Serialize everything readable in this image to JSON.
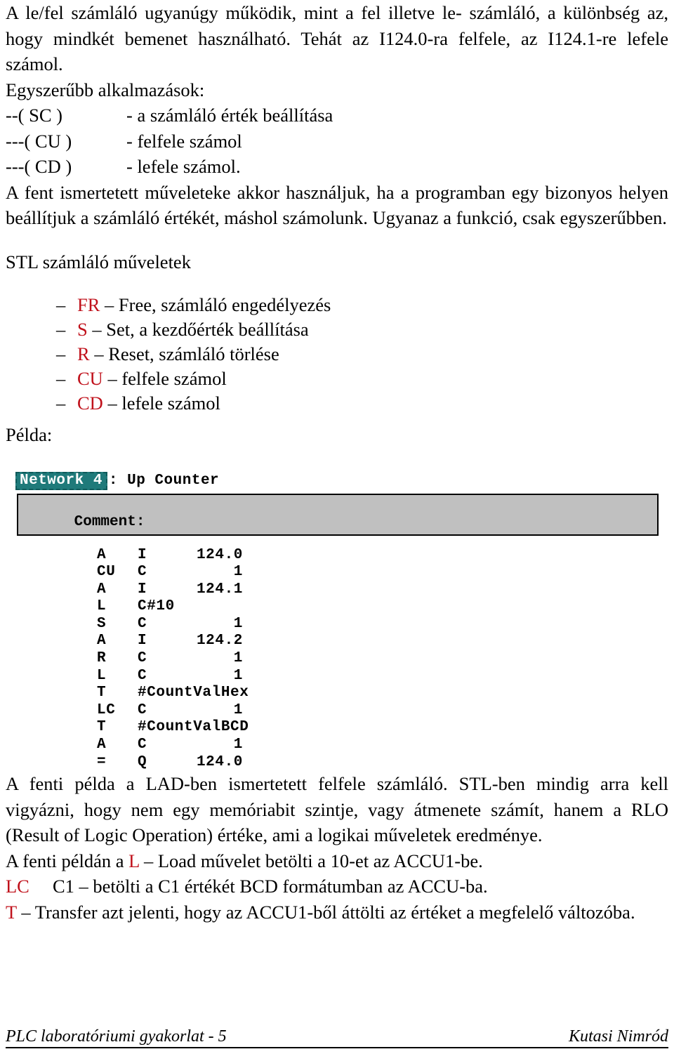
{
  "document": {
    "intro_paragraph": "A le/fel számláló ugyanúgy működik, mint a fel illetve le- számláló, a különbség az, hogy mindkét bemenet használható. Tehát az I124.0-ra felfele, az I124.1-re lefele számol.",
    "applications_heading": "Egyszerűbb alkalmazások:",
    "coil_rows": [
      {
        "symbol": "--( SC )",
        "description": "- a számláló érték beállítása"
      },
      {
        "symbol": "---( CU )",
        "description": "- felfele számol"
      },
      {
        "symbol": "---( CD )",
        "description": "- lefele számol."
      }
    ],
    "usage_paragraph": "A fent ismertetett műveleteke akkor használjuk, ha a programban egy bizonyos helyen beállítjuk a számláló értékét, máshol számolunk. Ugyanaz a funkció, csak egyszerűbben.",
    "stl_heading": "STL számláló műveletek",
    "stl_list": [
      {
        "bullet": "–",
        "code": "FR",
        "separator": " – ",
        "text": "Free, számláló engedélyezés"
      },
      {
        "bullet": "–",
        "code": "S",
        "separator": " – ",
        "text": "Set, a kezdőérték beállítása"
      },
      {
        "bullet": "–",
        "code": "R",
        "separator": " – ",
        "text": "Reset, számláló törlése"
      },
      {
        "bullet": "–",
        "code": "CU",
        "separator": " – ",
        "text": "felfele számol"
      },
      {
        "bullet": "–",
        "code": "CD",
        "separator": " – ",
        "text": "lefele számol"
      }
    ],
    "example_label": "Példa:",
    "screenshot": {
      "network_label": "Network 4",
      "network_title": ": Up Counter",
      "comment_label": "Comment:",
      "code_lines": [
        {
          "op": "A",
          "area": "I",
          "addr": "124.0"
        },
        {
          "op": "CU",
          "area": "C",
          "addr": "1"
        },
        {
          "op": "A",
          "area": "I",
          "addr": "124.1"
        },
        {
          "op": "L",
          "area": "C#10",
          "addr": ""
        },
        {
          "op": "S",
          "area": "C",
          "addr": "1"
        },
        {
          "op": "A",
          "area": "I",
          "addr": "124.2"
        },
        {
          "op": "R",
          "area": "C",
          "addr": "1"
        },
        {
          "op": "L",
          "area": "C",
          "addr": "1"
        },
        {
          "op": "T",
          "area": "#CountValHex",
          "addr": ""
        },
        {
          "op": "LC",
          "area": "C",
          "addr": "1"
        },
        {
          "op": "T",
          "area": "#CountValBCD",
          "addr": ""
        },
        {
          "op": "A",
          "area": "C",
          "addr": "1"
        },
        {
          "op": "=",
          "area": "Q",
          "addr": "124.0"
        }
      ]
    },
    "explain_paragraph": "A fenti példa a LAD-ben ismertetett felfele számláló. STL-ben mindig arra kell vigyázni, hogy nem egy memóriabit szintje, vagy átmenete számít, hanem a RLO (Result of Logic Operation) értéke, ami a logikai műveletek eredménye.",
    "note_l_prefix": "A fenti példán a ",
    "note_l_code": "L",
    "note_l_rest": " – Load művelet betölti a 10-et az ACCU1-be.",
    "note_lc_code": "LC",
    "note_lc_rest": "     C1 – betölti a C1 értékét BCD formátumban az ACCU-ba.",
    "note_t_code": "T",
    "note_t_rest": " – Transfer azt jelenti, hogy az ACCU1-ből áttölti az értéket a megfelelő változóba."
  },
  "footer": {
    "left": "PLC laboratóriumi gyakorlat - 5",
    "right": "Kutasi Nimród"
  },
  "colors": {
    "accent_red": "#C0111B",
    "network_highlight": "#1f7a7a",
    "comment_box": "#C0C0C0"
  }
}
